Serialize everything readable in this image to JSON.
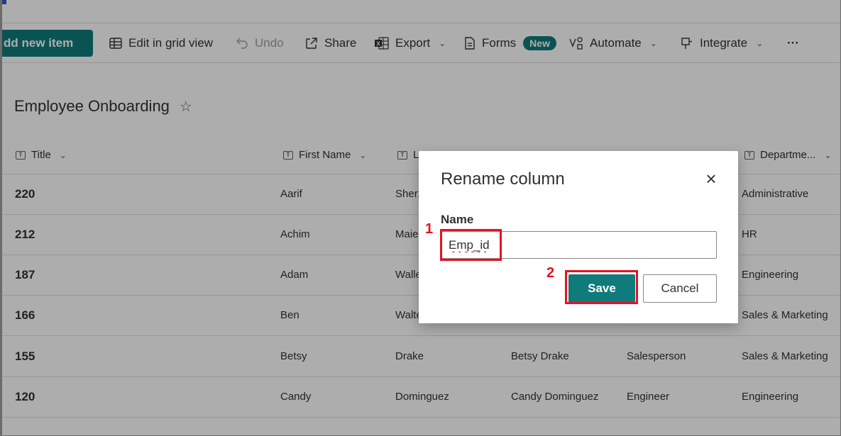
{
  "toolbar": {
    "new_item": "dd new item",
    "edit_grid": "Edit in grid view",
    "undo": "Undo",
    "share": "Share",
    "export": "Export",
    "forms": "Forms",
    "forms_badge": "New",
    "automate": "Automate",
    "integrate": "Integrate",
    "more": "···"
  },
  "list": {
    "title": "Employee Onboarding",
    "favorite_icon": "star-icon"
  },
  "columns": {
    "title": "Title",
    "first_name": "First Name",
    "last_name_partial": "L",
    "department": "Departme..."
  },
  "rows": [
    {
      "title": "220",
      "first": "Aarif",
      "last": "Sherz",
      "display": "",
      "job": "",
      "dept": "Administrative"
    },
    {
      "title": "212",
      "first": "Achim",
      "last": "Maie",
      "display": "",
      "job": "",
      "dept": "HR"
    },
    {
      "title": "187",
      "first": "Adam",
      "last": "Walle",
      "display": "",
      "job": "",
      "dept": "Engineering"
    },
    {
      "title": "166",
      "first": "Ben",
      "last": "Walte",
      "display": "",
      "job": "",
      "dept": "Sales & Marketing"
    },
    {
      "title": "155",
      "first": "Betsy",
      "last": "Drake",
      "display": "Betsy Drake",
      "job": "Salesperson",
      "dept": "Sales & Marketing"
    },
    {
      "title": "120",
      "first": "Candy",
      "last": "Dominguez",
      "display": "Candy Dominguez",
      "job": "Engineer",
      "dept": "Engineering"
    }
  ],
  "dialog": {
    "title": "Rename column",
    "close": "×",
    "name_label": "Name",
    "name_value": "Emp_id",
    "save": "Save",
    "cancel": "Cancel"
  },
  "annotations": {
    "step1": "1",
    "step2": "2",
    "highlight_color": "#e81123"
  },
  "colors": {
    "accent": "#0f7b7b"
  }
}
